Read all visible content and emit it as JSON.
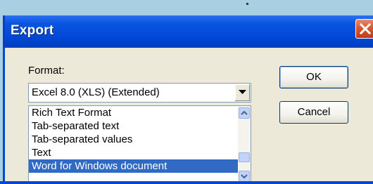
{
  "dialog": {
    "title": "Export",
    "close_icon": "close-icon"
  },
  "format": {
    "label": "Format:",
    "selected": "Excel 8.0 (XLS) (Extended)",
    "options": [
      "Rich Text Format",
      "Tab-separated text",
      "Tab-separated values",
      "Text",
      "Word for Windows document"
    ],
    "highlighted_index": 4
  },
  "buttons": {
    "ok_label": "OK",
    "cancel_label": "Cancel"
  },
  "colors": {
    "titlebar": "#0047d4",
    "close_button": "#d9582f",
    "selection": "#316ac5",
    "dialog_face": "#ece9d8"
  }
}
